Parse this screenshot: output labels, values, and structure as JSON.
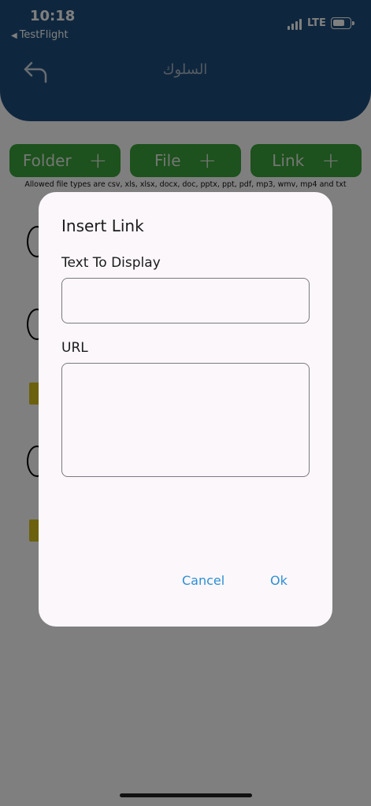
{
  "status_bar": {
    "time": "10:18",
    "back_app": "TestFlight",
    "network": "LTE"
  },
  "header": {
    "title": "السلوك",
    "back_icon": "back-arrow-icon"
  },
  "actions": {
    "folder_label": "Folder",
    "file_label": "File",
    "link_label": "Link",
    "plus": "+",
    "allowed_note": "Allowed file types are csv, xls, xlsx, docx, doc, pptx, ppt, pdf, mp3, wmv, mp4 and txt"
  },
  "dialog": {
    "title": "Insert Link",
    "text_label": "Text To Display",
    "text_value": "",
    "url_label": "URL",
    "url_value": "",
    "cancel_label": "Cancel",
    "ok_label": "Ok"
  },
  "colors": {
    "header": "#1f4f7c",
    "action_button": "#3aa23a",
    "dialog_background": "#fbf7fb",
    "dialog_button": "#2f8fd2"
  }
}
